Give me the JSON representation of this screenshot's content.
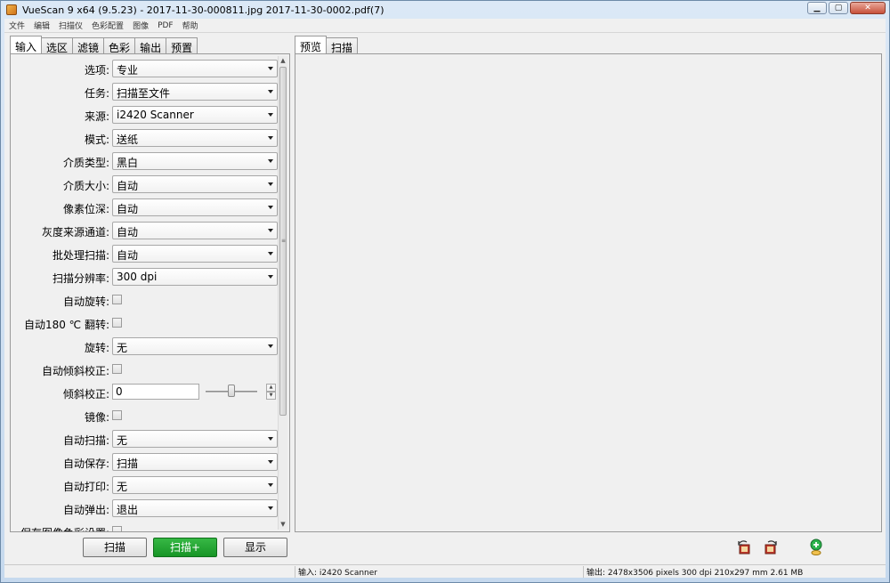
{
  "window": {
    "title": "VueScan 9 x64 (9.5.23) - 2017-11-30-000811.jpg 2017-11-30-0002.pdf(7)"
  },
  "menu": [
    "文件",
    "编辑",
    "扫描仪",
    "色彩配置",
    "图像",
    "PDF",
    "帮助"
  ],
  "left_tabs": [
    "输入",
    "选区",
    "滤镜",
    "色彩",
    "输出",
    "预置"
  ],
  "right_tabs": [
    "预览",
    "扫描"
  ],
  "fields": {
    "options": {
      "label": "选项:",
      "value": "专业"
    },
    "task": {
      "label": "任务:",
      "value": "扫描至文件"
    },
    "source": {
      "label": "来源:",
      "value": "i2420 Scanner"
    },
    "mode": {
      "label": "模式:",
      "value": "送纸"
    },
    "media_type": {
      "label": "介质类型:",
      "value": "黑白"
    },
    "media_size": {
      "label": "介质大小:",
      "value": "自动"
    },
    "bit_depth": {
      "label": "像素位深:",
      "value": "自动"
    },
    "gray_channel": {
      "label": "灰度来源通道:",
      "value": "自动"
    },
    "batch_scan": {
      "label": "批处理扫描:",
      "value": "自动"
    },
    "resolution": {
      "label": "扫描分辨率:",
      "value": "300 dpi"
    },
    "auto_rotate": {
      "label": "自动旋转:"
    },
    "auto_flip": {
      "label": "自动180 ℃ 翻转:"
    },
    "rotate": {
      "label": "旋转:",
      "value": "无"
    },
    "auto_deskew": {
      "label": "自动倾斜校正:"
    },
    "deskew": {
      "label": "倾斜校正:",
      "value": "0",
      "slider_level": 0.5
    },
    "mirror": {
      "label": "镜像:"
    },
    "auto_scan": {
      "label": "自动扫描:",
      "value": "无"
    },
    "auto_save": {
      "label": "自动保存:",
      "value": "扫描"
    },
    "auto_print": {
      "label": "自动打印:",
      "value": "无"
    },
    "auto_eject": {
      "label": "自动弹出:",
      "value": "退出"
    },
    "save_color": {
      "label": "保存图像色彩设置:"
    }
  },
  "buttons": {
    "scan": "扫描",
    "scan_plus": "扫描+",
    "show": "显示"
  },
  "status": {
    "input": "输入: i2420 Scanner",
    "output": "输出: 2478x3506 pixels 300 dpi 210x297 mm 2.61 MB"
  },
  "colors": {
    "scan_plus_button": "#1e9e2d"
  }
}
